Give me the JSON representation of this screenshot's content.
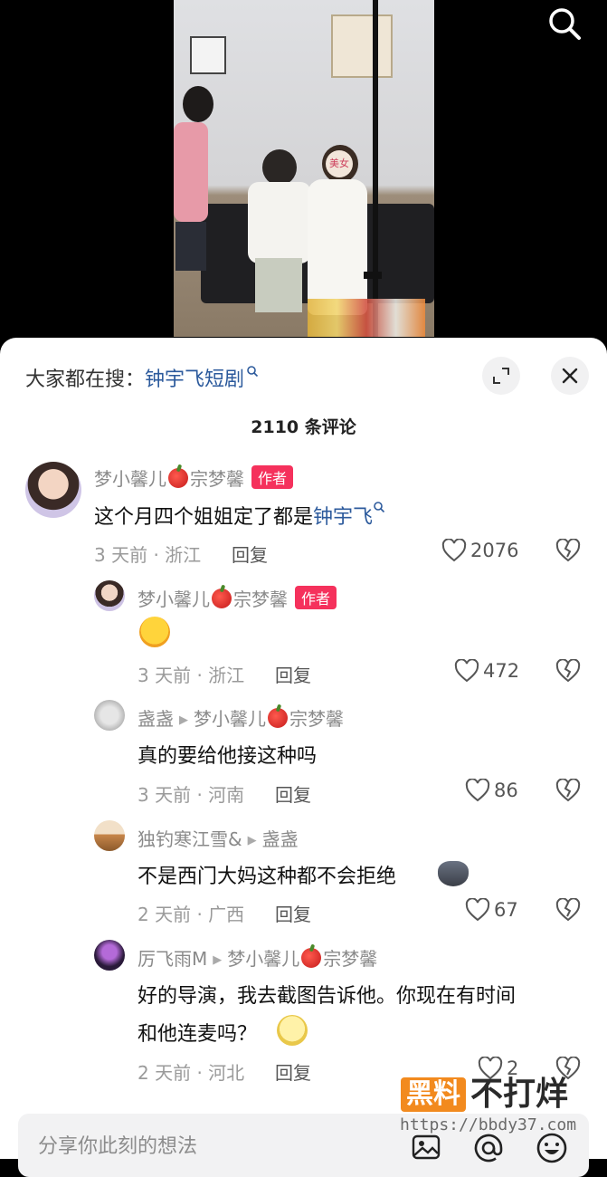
{
  "header": {
    "search_icon": "search-icon"
  },
  "panel": {
    "hot_prefix": "大家都在搜：",
    "hot_keyword": "钟宇飞短剧",
    "comment_count": "2110 条评论",
    "expand_icon": "expand-icon",
    "close_icon": "close-icon"
  },
  "comments": [
    {
      "user": "梦小馨儿",
      "user_suffix": "宗梦馨",
      "tag": "作者",
      "text_prefix": "这个月四个姐姐定了都是",
      "text_keyword": "钟宇飞",
      "time_loc": "3 天前 · 浙江",
      "reply": "回复",
      "likes": "2076"
    },
    {
      "user": "梦小馨儿",
      "user_suffix": "宗梦馨",
      "tag": "作者",
      "emoji": "laughing-crying-emoji",
      "time_loc": "3 天前 · 浙江",
      "reply": "回复",
      "likes": "472"
    },
    {
      "user": "盏盏",
      "reply_to": "梦小馨儿",
      "reply_to_suffix": "宗梦馨",
      "text": "真的要给他接这种吗",
      "time_loc": "3 天前 · 河南",
      "reply": "回复",
      "likes": "86"
    },
    {
      "user": "独钓寒江雪&",
      "reply_to": "盏盏",
      "text": "不是西门大妈这种都不会拒绝",
      "emoji": "wolf-emoji",
      "time_loc": "2 天前 · 广西",
      "reply": "回复",
      "likes": "67"
    },
    {
      "user": "厉飞雨M",
      "reply_to": "梦小馨儿",
      "reply_to_suffix": "宗梦馨",
      "text_line1": "好的导演，我去截图告诉他。你现在有时间",
      "text_line2": "和他连麦吗？",
      "emoji": "nerd-emoji",
      "time_loc": "2 天前 · 河北",
      "reply": "回复",
      "likes": "2"
    }
  ],
  "input": {
    "placeholder": "分享你此刻的想法",
    "image_icon": "image-icon",
    "at_icon": "at-icon",
    "emoji_icon": "emoji-icon"
  },
  "watermark": {
    "badge": "黑料",
    "title": "不打烊",
    "url": "https://bbdy37.com"
  },
  "video_overlay_text": "美女"
}
